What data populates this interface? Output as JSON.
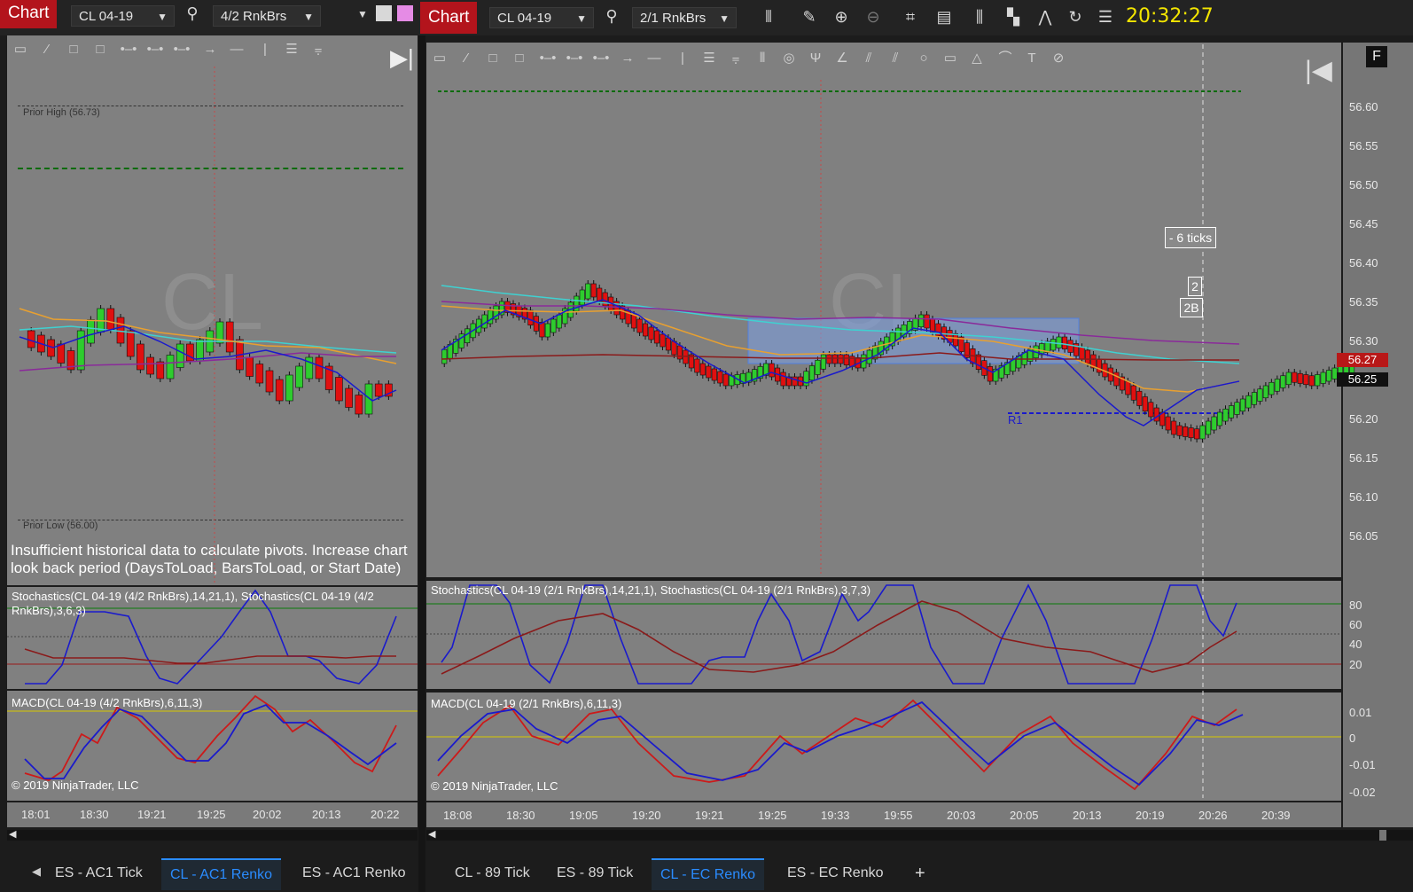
{
  "left_chart": {
    "chart_button": "Chart",
    "instrument": "CL 04-19",
    "bar_type": "4/2 RnkBrs",
    "prior_high": "Prior High (56.73)",
    "prior_low": "Prior Low (56.00)",
    "pivot_message": "Insufficient historical data to calculate pivots. Increase chart look back period (DaysToLoad, BarsToLoad, or Start Date)",
    "stoch_title": "Stochastics(CL 04-19 (4/2 RnkBrs),14,21,1), Stochastics(CL 04-19 (4/2 RnkBrs),3,6,3)",
    "macd_title": "MACD(CL 04-19 (4/2 RnkBrs),6,11,3)",
    "copyright": "© 2019 NinjaTrader, LLC",
    "time_labels": [
      "18:01",
      "18:30",
      "19:21",
      "19:25",
      "20:02",
      "20:13",
      "20:22"
    ],
    "watermark": "CL"
  },
  "right_chart": {
    "chart_button": "Chart",
    "instrument": "CL 04-19",
    "bar_type": "2/1 RnkBrs",
    "clock": "20:32:27",
    "price_labels": [
      "56.60",
      "56.55",
      "56.50",
      "56.45",
      "56.40",
      "56.35",
      "56.30",
      "56.20",
      "56.15",
      "56.10",
      "56.05"
    ],
    "price_tag_red": "56.27",
    "price_tag_black": "56.25",
    "ticks_label": "- 6 ticks",
    "tag_2": "2",
    "tag_2b": "2B",
    "r1_label": "R1",
    "stoch_title": "Stochastics(CL 04-19 (2/1 RnkBrs),14,21,1), Stochastics(CL 04-19 (2/1 RnkBrs),3,7,3)",
    "stoch_levels": [
      "80",
      "60",
      "40",
      "20"
    ],
    "macd_title": "MACD(CL 04-19 (2/1 RnkBrs),6,11,3)",
    "macd_levels": [
      "0.01",
      "0",
      "-0.01",
      "-0.02"
    ],
    "copyright": "© 2019 NinjaTrader, LLC",
    "time_labels": [
      "18:08",
      "18:30",
      "19:05",
      "19:20",
      "19:21",
      "19:25",
      "19:33",
      "19:55",
      "20:03",
      "20:05",
      "20:13",
      "20:19",
      "20:26",
      "20:39"
    ],
    "watermark": "CL",
    "f_button": "F"
  },
  "left_tabs": [
    "ES - AC1 Tick",
    "CL - AC1 Renko",
    "ES - AC1 Renko"
  ],
  "right_tabs": [
    "CL - 89 Tick",
    "ES - 89 Tick",
    "CL - EC Renko",
    "ES - EC Renko"
  ],
  "add_tab": "+",
  "colors": {
    "up_bar": "#2ecc2e",
    "down_bar": "#e01010",
    "bg": "#808080",
    "accent": "#2a8cff",
    "clock": "#f3e500"
  }
}
